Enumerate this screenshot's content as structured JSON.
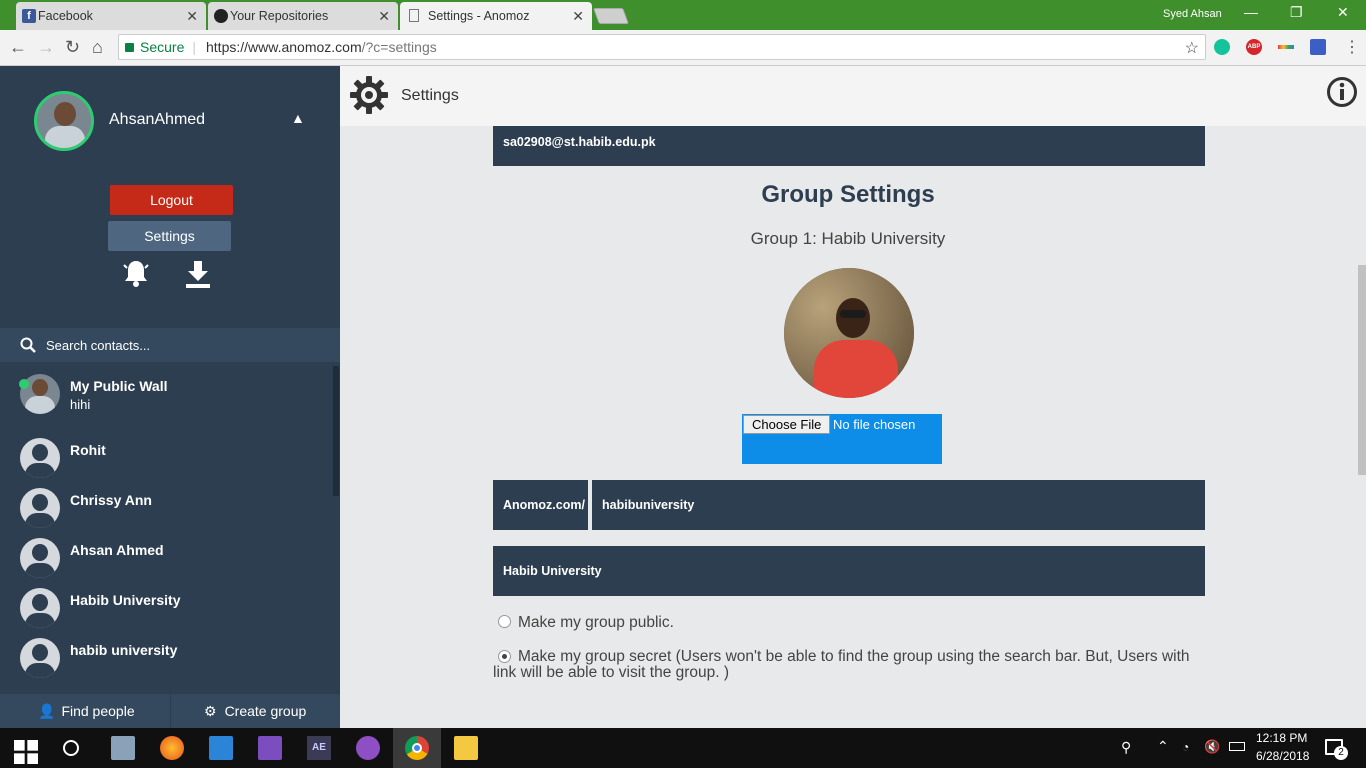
{
  "browser": {
    "tabs": [
      {
        "label": "Facebook",
        "active": false
      },
      {
        "label": "Your Repositories",
        "active": false
      },
      {
        "label": "Settings - Anomoz",
        "active": true
      }
    ],
    "user": "Syed Ahsan",
    "security_label": "Secure",
    "url_main": "https://www.anomoz.com",
    "url_rest": "/?c=settings"
  },
  "sidebar": {
    "profile_name": "AhsanAhmed",
    "logout_label": "Logout",
    "settings_label": "Settings",
    "search_placeholder": "Search contacts...",
    "contacts": [
      {
        "name": "My Public Wall",
        "status": "hihi"
      },
      {
        "name": "Rohit"
      },
      {
        "name": "Chrissy Ann"
      },
      {
        "name": "Ahsan Ahmed"
      },
      {
        "name": "Habib University"
      },
      {
        "name": "habib university"
      }
    ],
    "find_people_label": "Find people",
    "create_group_label": "Create group"
  },
  "header": {
    "title": "Settings"
  },
  "main": {
    "email": "sa02908@st.habib.edu.pk",
    "heading": "Group Settings",
    "group_subtitle": "Group 1: Habib University",
    "choose_file_label": "Choose File",
    "no_file_label": "No file chosen",
    "url_prefix": "Anomoz.com/",
    "url_slug": "habibuniversity",
    "group_name": "Habib University",
    "public_option": "Make my group public.",
    "secret_option": "Make my group secret (Users won't be able to find the group using the search bar. But, Users with link will be able to visit the group. )",
    "selected_option": "secret"
  },
  "taskbar": {
    "time": "12:18 PM",
    "date": "6/28/2018",
    "notification_count": "2"
  },
  "colors": {
    "sidebar_bg": "#2c3e50",
    "logout_red": "#c52a18",
    "online_green": "#2ecc71",
    "file_blue": "#0d8ce8",
    "tabstrip_green": "#3f8f2c"
  }
}
